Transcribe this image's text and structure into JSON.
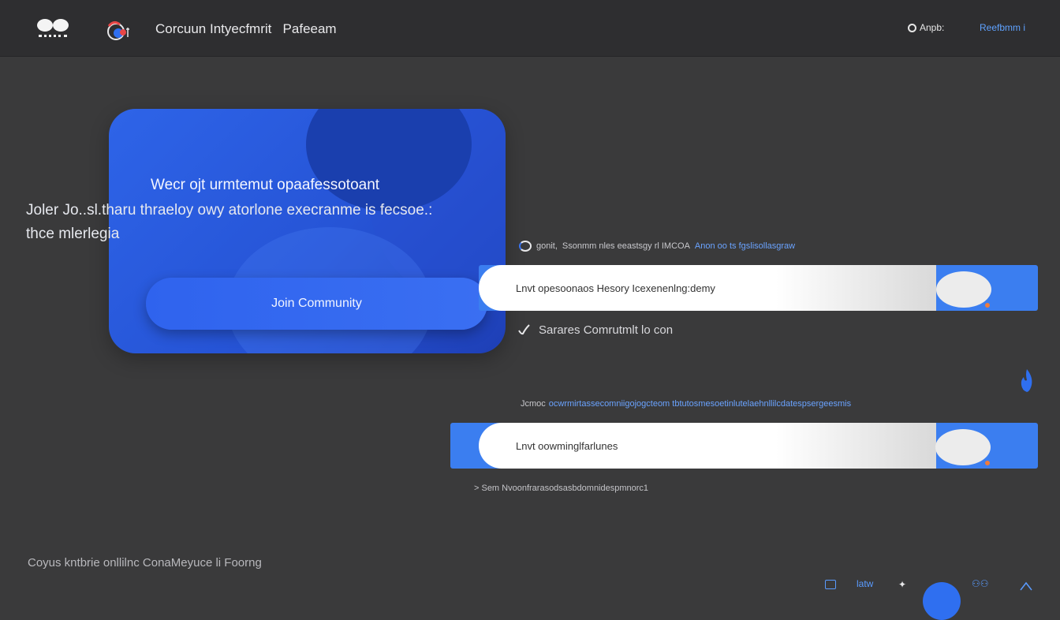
{
  "header": {
    "app_title": "Corcuun Intyecfmrit   Pafeeam",
    "right_link_1": "Anpb:",
    "right_link_2": "Reefbmm i"
  },
  "hero": {
    "heading": "Wecr ojt urmtemut opaafessotoant",
    "body_line_1": "Joler Jo..sl.tharu thraeloy owy atorlone execranme is fecsoe.:",
    "body_line_2": "thce mlerlegia",
    "join_button": "Join Community"
  },
  "list": {
    "row1_caption_prefix": "gonit,",
    "row1_caption_main": "Ssonmm nles eeastsgy rl IMCOA",
    "row1_caption_accent": "Anon oo ts fgslisollasgraw",
    "row1_bar_label": "Lnvt  opesoonaos Hesory Icexenenlng:demy",
    "check_label": "Sarares Comrutmlt lo con",
    "row2_caption": "Jcmoc",
    "row2_caption_accent": "ocwrmirtassecomniigojogcteom tbtutosmesoetinlutelaehnllilcdatespsergeesmis",
    "row2_bar_label": "Lnvt  oowminglfarlunes",
    "sub_caption": "> Sem  Nvoonfrarasodsasbdomnidespmnorc1"
  },
  "footer": {
    "text": "Coyus kntbrie onllilnc ConaMeyuce  li Foorng",
    "icon_text_1": "latw"
  },
  "colors": {
    "accent_blue": "#3b7ef0",
    "link_blue": "#5fa2ff",
    "toggle_dot": "#ee7b3c"
  },
  "icons": [
    "logo-mark-icon",
    "globe-icon",
    "clock-icon",
    "check-icon",
    "flame-icon",
    "square-icon",
    "settings-icon",
    "group-icon",
    "chevron-up-icon"
  ]
}
